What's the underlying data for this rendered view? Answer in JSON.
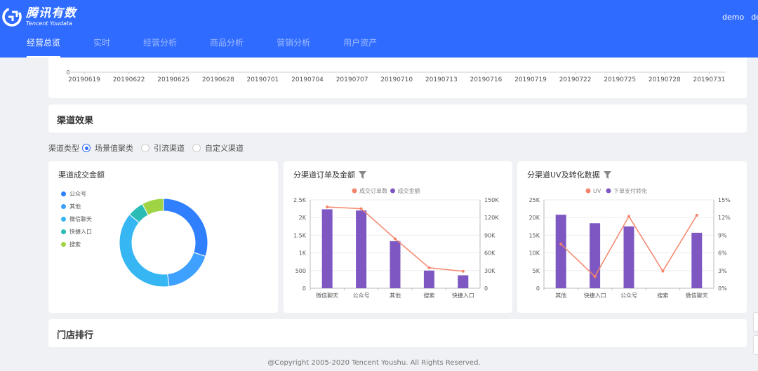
{
  "header": {
    "logo_cn": "腾讯有数",
    "logo_en": "Tencent Youdata",
    "user": "demo",
    "user_extra": "de",
    "nav": [
      {
        "label": "经营总览",
        "active": true
      },
      {
        "label": "实时",
        "active": false
      },
      {
        "label": "经营分析",
        "active": false
      },
      {
        "label": "商品分析",
        "active": false
      },
      {
        "label": "营销分析",
        "active": false
      },
      {
        "label": "用户资产",
        "active": false
      }
    ]
  },
  "trend_axis": {
    "zero_label": "0",
    "dates": [
      "20190619",
      "20190622",
      "20190625",
      "20190628",
      "20190701",
      "20190704",
      "20190707",
      "20190710",
      "20190713",
      "20190716",
      "20190719",
      "20190722",
      "20190725",
      "20190728",
      "20190731"
    ]
  },
  "channel_section": {
    "title": "渠道效果",
    "channel_type_label": "渠道类型",
    "options": [
      {
        "label": "场景值聚类",
        "checked": true
      },
      {
        "label": "引流渠道",
        "checked": false
      },
      {
        "label": "自定义渠道",
        "checked": false
      }
    ]
  },
  "store_section": {
    "title": "门店排行"
  },
  "footer": {
    "copyright": "@Copyright 2005-2020 Tencent Youshu. All Rights Reserved."
  },
  "colors": {
    "brand": "#2f6bff",
    "bar": "#7e57c2",
    "line": "#f4846b"
  },
  "chart_data": [
    {
      "type": "pie",
      "variant": "donut",
      "title": "渠道成交金额",
      "legend_position": "left",
      "categories": [
        "公众号",
        "其他",
        "微信聊天",
        "快捷入口",
        "搜索"
      ],
      "values": [
        30,
        18,
        38,
        6,
        8
      ],
      "colors": [
        "#2f7fff",
        "#3ea0ff",
        "#36b6f2",
        "#2cbcb6",
        "#9fd545"
      ]
    },
    {
      "type": "bar",
      "title": "分渠道订单及金额",
      "legend_position": "top",
      "categories": [
        "微信聊天",
        "公众号",
        "其他",
        "搜索",
        "快捷入口"
      ],
      "left_ticks": [
        "0",
        "500",
        "1K",
        "1.5K",
        "2K",
        "2.5K"
      ],
      "right_ticks": [
        "0",
        "30K",
        "60K",
        "90K",
        "120K",
        "150K"
      ],
      "ylim_left": [
        0,
        2500
      ],
      "ylim_right": [
        0,
        150000
      ],
      "series": [
        {
          "name": "成交订单数",
          "kind": "line",
          "axis": "left",
          "color": "#f4846b",
          "values": [
            2300,
            2250,
            1400,
            580,
            480
          ]
        },
        {
          "name": "成交金额",
          "kind": "bar",
          "axis": "right",
          "color": "#7e57c2",
          "values": [
            134000,
            132000,
            80000,
            30000,
            22000
          ]
        }
      ]
    },
    {
      "type": "bar",
      "title": "分渠道UV及转化数据",
      "legend_position": "top",
      "categories": [
        "其他",
        "快捷入口",
        "公众号",
        "搜索",
        "微信聊天"
      ],
      "left_ticks": [
        "0",
        "5K",
        "10K",
        "15K",
        "20K",
        "25K"
      ],
      "right_ticks": [
        "0%",
        "3%",
        "6%",
        "9%",
        "12%",
        "15%"
      ],
      "ylim_left": [
        0,
        25000
      ],
      "ylim_right": [
        0,
        15
      ],
      "series": [
        {
          "name": "UV",
          "kind": "line",
          "axis": "right",
          "color": "#f4846b",
          "values": [
            7.5,
            2.0,
            12.2,
            2.9,
            12.4
          ]
        },
        {
          "name": "下单支付转化",
          "kind": "bar",
          "axis": "left",
          "color": "#7e57c2",
          "values": [
            20800,
            18400,
            17500,
            null,
            15700
          ]
        }
      ]
    }
  ]
}
